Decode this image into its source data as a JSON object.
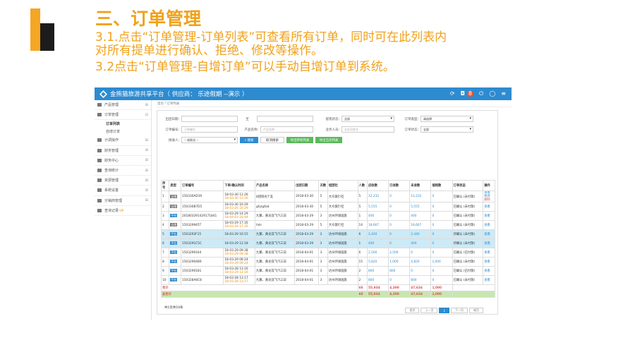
{
  "slide": {
    "title": "三、订单管理",
    "lines": [
      "3.1.点击“订单管理-订单列表”可查看所有订单，同时可在此列表内",
      "对所有提单进行确认、拒绝、修改等操作。",
      "3.2点击“订单管理-自增订单”可以手动自增订单到系统。"
    ],
    "colors": {
      "accent": "#f0a21b",
      "logo_yellow": "#f5a623",
      "logo_black": "#1c1c1c",
      "brand_blue": "#2e8bd0"
    }
  },
  "app": {
    "title": "金熊猫旅游共享平台（ 供应商： 乐途假期 --演示 ）",
    "notify_count": "8",
    "icons": [
      "refresh-icon",
      "bell-icon",
      "power-icon",
      "chat-icon",
      "menu-icon"
    ]
  },
  "sidebar": {
    "items": [
      {
        "label": "产品管理"
      },
      {
        "label": "订单管理"
      },
      {
        "label": "计调操作"
      },
      {
        "label": "财务管理"
      },
      {
        "label": "财务中心"
      },
      {
        "label": "查询统计"
      },
      {
        "label": "资源管理"
      },
      {
        "label": "系统设置"
      },
      {
        "label": "分销商管理"
      },
      {
        "label": "查询记录",
        "vip": "VIP"
      }
    ],
    "subitems": [
      "订单列表",
      "自增订单"
    ]
  },
  "breadcrumb": {
    "home": "首页",
    "sep": "/",
    "current": "订单列表"
  },
  "filters": {
    "date_label": "出团日期：",
    "to_label": "至",
    "status_label": "提现状态：",
    "status_value": "全部",
    "type_label": "订单类型：",
    "type_value": "请选择",
    "order_no_label": "订单编号：",
    "order_no_placeholder": "订单编号",
    "product_label": "产品名称：",
    "product_placeholder": "产品名称",
    "sales_label": "业务人员：",
    "sales_placeholder": "业务员姓名",
    "order_status_label": "订单状态：",
    "order_status_value": "全部",
    "receive_label": "接收人：",
    "receive_value": "-- 收款员 --",
    "search_btn": "搜索",
    "cancel_btn": "取消搜索",
    "export_all_btn": "导出所有列表",
    "export_cur_btn": "导出当页列表"
  },
  "table": {
    "headers": [
      "序号",
      "类型",
      "订单编号",
      "下单/确认时间",
      "产品名称",
      "出团日期",
      "天数",
      "组团社",
      "人数",
      "应收款",
      "已收款",
      "未收款",
      "报税款",
      "订单状态",
      "操作"
    ],
    "rows": [
      {
        "no": "1",
        "type": "自增",
        "order": "150330AD19",
        "t1": "18-03-30 11:26",
        "t2": "18-03-30 11:26",
        "product": "8团阳光个友",
        "date": "2018-03-30",
        "days": "5",
        "agency": "大众旅行社",
        "people": "5",
        "due": "12,232",
        "paid": "0",
        "unpaid": "12,232",
        "tax": "0",
        "status": "已确认 (未付款)",
        "ops": [
          "查看",
          "修改",
          "删除"
        ],
        "hl": false
      },
      {
        "no": "2",
        "type": "自增",
        "order": "150330B7D5",
        "t1": "18-03-30 10:29",
        "t2": "18-03-26 10:29",
        "product": "ghjsgfad",
        "date": "2018-03-30",
        "days": "5",
        "agency": "大众旅行社",
        "people": "5",
        "due": "5,555",
        "paid": "0",
        "unpaid": "5,555",
        "tax": "0",
        "status": "已确认 (未付款)",
        "ops": [
          "查看"
        ],
        "hl": false
      },
      {
        "no": "3",
        "type": "平台",
        "order": "201803291429171841",
        "t1": "18-03-29 14:29",
        "t2": "18-04-03 16:44",
        "product": "九寨、黄龙双飞汽三日",
        "date": "2018-03-29",
        "days": "3",
        "agency": "达州环球国旅",
        "people": "1",
        "due": "400",
        "paid": "0",
        "unpaid": "400",
        "tax": "0",
        "status": "已确认 (未付款)",
        "ops": [
          "查看"
        ],
        "hl": false
      },
      {
        "no": "4",
        "type": "自增",
        "order": "150329945T",
        "t1": "18-03-29 17:35",
        "t2": "18-03-29 17:35",
        "product": "hds",
        "date": "2018-03-29",
        "days": "5",
        "agency": "大众旅行社",
        "people": "14",
        "due": "18,667",
        "paid": "0",
        "unpaid": "18,667",
        "tax": "0",
        "status": "已确认 (未付款)",
        "ops": [
          "查看"
        ],
        "hl": false
      },
      {
        "no": "5",
        "type": "平台",
        "order": "1503292F15",
        "t1": "18-03-29 10:15",
        "t2": "",
        "product": "九寨、黄龙双飞汽三日",
        "date": "2018-03-29",
        "days": "3",
        "agency": "达州环球国旅",
        "people": "6",
        "due": "2,440",
        "paid": "0",
        "unpaid": "2,440",
        "tax": "0",
        "status": "待确认 (未付款)",
        "ops": [
          "查看"
        ],
        "hl": true
      },
      {
        "no": "6",
        "type": "平台",
        "order": "1503291C5C",
        "t1": "18-03-29 12:18",
        "t2": "",
        "product": "九寨、黄龙双飞汽三日",
        "date": "2018-03-29",
        "days": "3",
        "agency": "达州环球国旅",
        "people": "1",
        "due": "400",
        "paid": "0",
        "unpaid": "400",
        "tax": "0",
        "status": "待确认 (未付款)",
        "ops": [
          "查看"
        ],
        "hl": true
      },
      {
        "no": "7",
        "type": "平台",
        "order": "1503290164",
        "t1": "18-03-29 09:38",
        "t2": "18-03-29 09:38",
        "product": "九寨、黄龙双飞汽三日",
        "date": "2018-04-01",
        "days": "3",
        "agency": "达州环球国旅",
        "people": "6",
        "due": "2,500",
        "paid": "2,500",
        "unpaid": "0",
        "tax": "0",
        "status": "已确认 (已付款)",
        "ops": [
          "查看"
        ],
        "hl": false
      },
      {
        "no": "8",
        "type": "平台",
        "order": "15032904B9",
        "t1": "18-03-29 09:24",
        "t2": "18-03-29 09:24",
        "product": "九寨、黄龙双飞汽三日",
        "date": "2018-04-01",
        "days": "3",
        "agency": "达州环球国旅",
        "people": "15",
        "due": "5,820",
        "paid": "1,000",
        "unpaid": "4,820",
        "tax": "1,000",
        "status": "已确认 (未付款)",
        "ops": [
          "查看"
        ],
        "hl": false
      },
      {
        "no": "9",
        "type": "平台",
        "order": "1503290181",
        "t1": "18-03-28 13:16",
        "t2": "18-03-29 13:16",
        "product": "九寨、黄龙双飞汽三日",
        "date": "2018-04-01",
        "days": "3",
        "agency": "达州环球国旅",
        "people": "2",
        "due": "800",
        "paid": "800",
        "unpaid": "0",
        "tax": "0",
        "status": "已确认 (已付款)",
        "ops": [
          "查看"
        ],
        "hl": false
      },
      {
        "no": "10",
        "type": "平台",
        "order": "150328A6C8",
        "t1": "18-03-28 13:17",
        "t2": "18-03-28 13:17",
        "product": "九寨、黄龙双飞汽三日",
        "date": "2018-04-01",
        "days": "3",
        "agency": "达州环球国旅",
        "people": "2",
        "due": "800",
        "paid": "0",
        "unpaid": "800",
        "tax": "0",
        "status": "已确认 (未付款)",
        "ops": [
          "查看"
        ],
        "hl": false
      }
    ],
    "sum": {
      "label": "合计",
      "people": "60",
      "due": "55,934",
      "paid": "4,300",
      "unpaid": "47,634",
      "tax": "1,000"
    },
    "total": {
      "label": "总合计",
      "people": "60",
      "due": "55,934",
      "paid": "4,300",
      "unpaid": "47,634",
      "tax": "1,000"
    }
  },
  "pager": {
    "info": "共1页共10条",
    "first": "首页",
    "prev": "上一页",
    "current": "1",
    "next": "下一页",
    "last": "尾页"
  }
}
